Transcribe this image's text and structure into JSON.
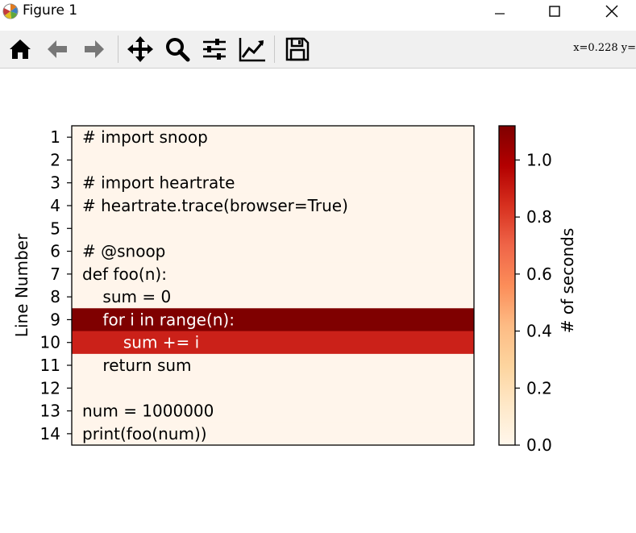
{
  "window": {
    "title": "Figure 1",
    "minimize_label": "Minimize",
    "maximize_label": "Maximize",
    "close_label": "Close"
  },
  "toolbar": {
    "buttons": [
      "home-icon",
      "back-arrow-icon",
      "forward-arrow-icon",
      "pan-icon",
      "zoom-icon",
      "subplots-config-icon",
      "edit-curve-icon",
      "save-icon"
    ],
    "coord_readout": "x=0.228 y="
  },
  "chart_data": {
    "type": "heatmap",
    "ylabel": "Line Number",
    "colorbar_label": "# of seconds",
    "colormap": "OrRd",
    "colorbar_range": [
      0,
      1.12
    ],
    "colorbar_ticks": [
      "0.0",
      "0.2",
      "0.4",
      "0.6",
      "0.8",
      "1.0"
    ],
    "colorbar_tick_values": [
      0.0,
      0.2,
      0.4,
      0.6,
      0.8,
      1.0
    ],
    "line_numbers": [
      "1",
      "2",
      "3",
      "4",
      "5",
      "6",
      "7",
      "8",
      "9",
      "10",
      "11",
      "12",
      "13",
      "14"
    ],
    "lines": [
      "# import snoop",
      "",
      "# import heartrate",
      "# heartrate.trace(browser=True)",
      "",
      "# @snoop",
      "def foo(n):",
      "    sum = 0",
      "    for i in range(n):",
      "        sum += i",
      "    return sum",
      "",
      "num = 1000000",
      "print(foo(num))"
    ],
    "seconds": [
      0,
      0,
      0,
      0,
      0,
      0,
      0,
      0,
      1.12,
      0.82,
      0,
      0,
      0,
      0
    ],
    "colors": {
      "zero": "#fff5eb",
      "line9": "#7f0000",
      "line10": "#cb2119"
    }
  }
}
